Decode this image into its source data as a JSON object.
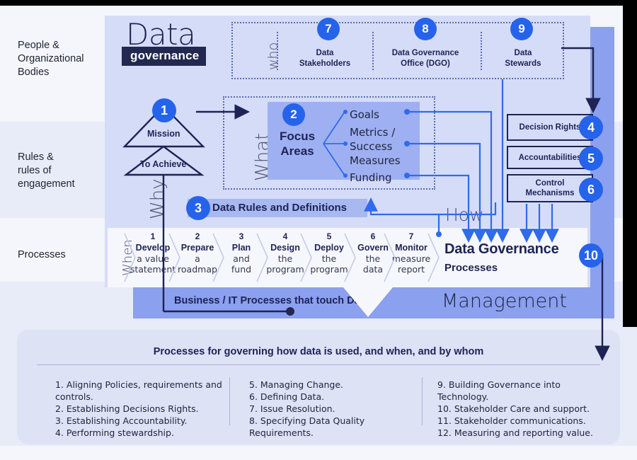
{
  "row_labels": [
    {
      "text": "People &\nOrganizational\nBodies",
      "line1": "People &",
      "line2": "Organizational",
      "line3": "Bodies"
    },
    {
      "line1": "Rules &",
      "line2": "rules of",
      "line3": "engagement"
    },
    {
      "line1": "Processes",
      "line2": "",
      "line3": ""
    }
  ],
  "logo": {
    "word": "Data",
    "bar": "governance"
  },
  "axis_labels": {
    "who": "who",
    "what": "What",
    "why": "Why",
    "when": "When",
    "how": "How"
  },
  "who": {
    "items": [
      {
        "badge": "7",
        "label_line1": "Data",
        "label_line2": "Stakeholders"
      },
      {
        "badge": "8",
        "label_line1": "Data Governance",
        "label_line2": "Office (DGO)"
      },
      {
        "badge": "9",
        "label_line1": "Data",
        "label_line2": "Stewards"
      }
    ]
  },
  "mission": {
    "badge": "1",
    "top_label": "Mission",
    "bottom_label": "To Achieve"
  },
  "focus": {
    "badge": "2",
    "title_line1": "Focus",
    "title_line2": "Areas",
    "items": [
      {
        "text": "Goals"
      },
      {
        "text": "Metrics /"
      },
      {
        "text": "Success"
      },
      {
        "text": "Measures"
      },
      {
        "text": "Funding"
      }
    ]
  },
  "rules_bar": {
    "badge": "3",
    "label": "Data Rules and Definitions"
  },
  "right_boxes": [
    {
      "badge": "4",
      "label": "Decision Rights"
    },
    {
      "badge": "5",
      "label": "Accountabilities"
    },
    {
      "badge": "6",
      "label_line1": "Control",
      "label_line2": "Mechanisms"
    }
  ],
  "process": {
    "steps": [
      {
        "num": "1",
        "verb": "Develop",
        "rest_line1": "a value",
        "rest_line2": "statement"
      },
      {
        "num": "2",
        "verb": "Prepare",
        "rest_line1": "a",
        "rest_line2": "roadmap"
      },
      {
        "num": "3",
        "verb": "Plan",
        "rest_line1": "and",
        "rest_line2": "fund"
      },
      {
        "num": "4",
        "verb": "Design",
        "rest_line1": "the",
        "rest_line2": "program"
      },
      {
        "num": "5",
        "verb": "Deploy",
        "rest_line1": "the",
        "rest_line2": "program"
      },
      {
        "num": "6",
        "verb": "Govern",
        "rest_line1": "the",
        "rest_line2": "data"
      },
      {
        "num": "7",
        "verb": "Monitor",
        "rest_line1": "measure",
        "rest_line2": "report"
      }
    ],
    "title": "Data Governance",
    "subtitle": "Processes",
    "badge": "10"
  },
  "business_band": {
    "label": "Business / IT Processes that touch Data",
    "management": "Management"
  },
  "legend": {
    "title": "Processes for governing how data is used, and when, and by whom",
    "col1": [
      "1. Aligning Policies, requirements and controls.",
      "2. Establishing Decisions Rights.",
      "3. Establishing Accountability.",
      "4. Performing stewardship."
    ],
    "col2": [
      "5. Managing Change.",
      "6. Defining Data.",
      "7. Issue Resolution.",
      "8. Specifying Data Quality Requirements."
    ],
    "col3": [
      "9. Building Governance into Technology.",
      "10. Stakeholder Care and support.",
      "11. Stakeholder communications.",
      "12. Measuring and reporting value."
    ]
  },
  "colors": {
    "badge_blue": "#2563eb",
    "panel_light": "#d5dcf8",
    "band_mid": "#8ba0ef",
    "focus_box": "#9eb0f2",
    "ink": "#1d2355",
    "page_a": "#f4f6fb",
    "page_b": "#e8ebf8",
    "legend_bg": "#dde2f5"
  }
}
